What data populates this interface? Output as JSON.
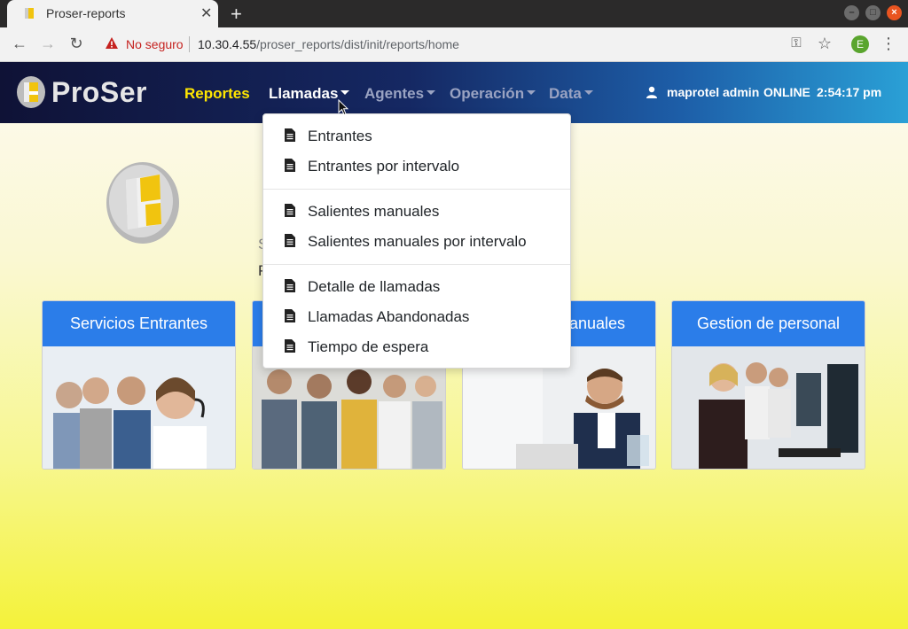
{
  "browser": {
    "tab_title": "Proser-reports",
    "tab_close": "✕",
    "new_tab": "+",
    "security_label": "No seguro",
    "url_host": "10.30.4.55",
    "url_path": "/proser_reports/dist/init/reports/home",
    "profile_initial": "E"
  },
  "navbar": {
    "logo_text": "ProSer",
    "items": [
      {
        "label": "Reportes",
        "has_caret": false
      },
      {
        "label": "Llamadas",
        "has_caret": true
      },
      {
        "label": "Agentes",
        "has_caret": true
      },
      {
        "label": "Operación",
        "has_caret": true
      },
      {
        "label": "Data",
        "has_caret": true
      }
    ],
    "user_name": "maprotel admin",
    "status": "ONLINE",
    "time": "2:54:17 pm"
  },
  "dropdown": {
    "groups": [
      [
        "Entrantes",
        "Entrantes por intervalo"
      ],
      [
        "Salientes manuales",
        "Salientes manuales por intervalo"
      ],
      [
        "Detalle de llamadas",
        "Llamadas Abandonadas",
        "Tiempo de espera"
      ]
    ]
  },
  "background_text": {
    "line1": "S",
    "line2": "P"
  },
  "cards": [
    {
      "title": "Servicios Entrantes"
    },
    {
      "title": ""
    },
    {
      "title": "anuales"
    },
    {
      "title": "Gestion de personal"
    }
  ],
  "colors": {
    "active_nav": "#ffe600",
    "card_header": "#2b7de9",
    "insecure": "#c5221f"
  }
}
